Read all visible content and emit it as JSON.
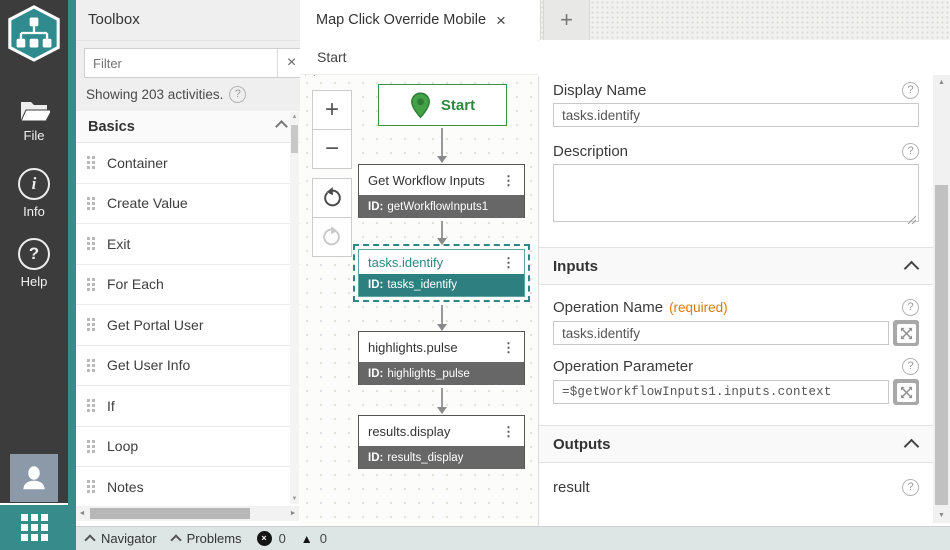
{
  "sidebar": {
    "items": [
      {
        "label": "File"
      },
      {
        "label": "Info"
      },
      {
        "label": "Help"
      }
    ]
  },
  "toolbox": {
    "title": "Toolbox",
    "filter_placeholder": "Filter",
    "showing_text": "Showing 203 activities.",
    "section_basics": "Basics",
    "items": [
      "Container",
      "Create Value",
      "Exit",
      "For Each",
      "Get Portal User",
      "Get User Info",
      "If",
      "Loop",
      "Notes"
    ]
  },
  "tabs": {
    "active_label": "Map Click Override Mobile"
  },
  "breadcrumb": {
    "root": "Start"
  },
  "canvas": {
    "start_label": "Start",
    "nodes": [
      {
        "title": "Get Workflow Inputs",
        "id_label": "ID:",
        "id_value": "getWorkflowInputs1"
      },
      {
        "title": "tasks.identify",
        "id_label": "ID:",
        "id_value": "tasks_identify"
      },
      {
        "title": "highlights.pulse",
        "id_label": "ID:",
        "id_value": "highlights_pulse"
      },
      {
        "title": "results.display",
        "id_label": "ID:",
        "id_value": "results_display"
      }
    ]
  },
  "properties": {
    "display_name_label": "Display Name",
    "display_name_value": "tasks.identify",
    "description_label": "Description",
    "description_value": "",
    "inputs_header": "Inputs",
    "operation_name_label": "Operation Name",
    "required_label": "(required)",
    "operation_name_value": "tasks.identify",
    "operation_parameter_label": "Operation Parameter",
    "operation_parameter_value": "=$getWorkflowInputs1.inputs.context",
    "outputs_header": "Outputs",
    "output_result": "result"
  },
  "statusbar": {
    "navigator_label": "Navigator",
    "problems_label": "Problems",
    "error_count": "0",
    "warning_count": "0"
  },
  "icons": {
    "close": "×",
    "plus": "+",
    "minus": "−",
    "kebab": "⋮",
    "error": "×",
    "warning": "▲",
    "question": "?",
    "info_letter": "i",
    "scroll_up": "▲",
    "scroll_down": "▼",
    "scroll_left": "◄",
    "scroll_right": "►"
  },
  "colors": {
    "teal": "#2e8787",
    "green": "#2f8a3d",
    "orange": "#dd7a00",
    "sidebar_bg": "#3c3c3c"
  }
}
